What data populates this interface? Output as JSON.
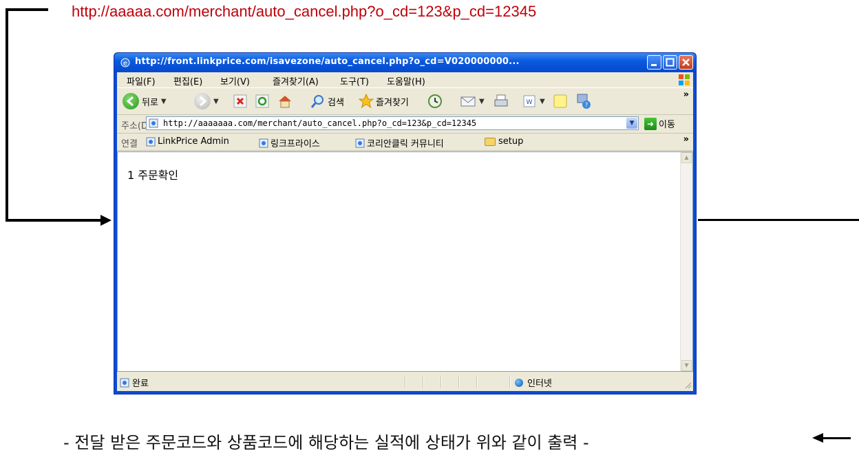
{
  "annotation": {
    "url_text": "http://aaaaa.com/merchant/auto_cancel.php?o_cd=123&p_cd=12345",
    "caption": "- 전달 받은 주문코드와 상품코드에 해당하는 실적에 상태가 위와 같이 출력 -"
  },
  "window": {
    "title": "http://front.linkprice.com/isavezone/auto_cancel.php?o_cd=V020000000..."
  },
  "menu": [
    "파일(F)",
    "편집(E)",
    "보기(V)",
    "즐겨찾기(A)",
    "도구(T)",
    "도움말(H)"
  ],
  "toolbar": {
    "back_label": "뒤로",
    "search_label": "검색",
    "favorites_label": "즐겨찾기"
  },
  "address": {
    "label": "주소(D)",
    "url": "http://aaaaaaa.com/merchant/auto_cancel.php?o_cd=123&p_cd=12345",
    "go_label": "이동"
  },
  "links": {
    "label": "연결",
    "items": [
      "LinkPrice Admin",
      "링크프라이스",
      "코리안클릭 커뮤니티",
      "setup"
    ]
  },
  "content": {
    "text": "1 주문확인"
  },
  "status": {
    "text": "완료",
    "zone": "인터넷"
  }
}
